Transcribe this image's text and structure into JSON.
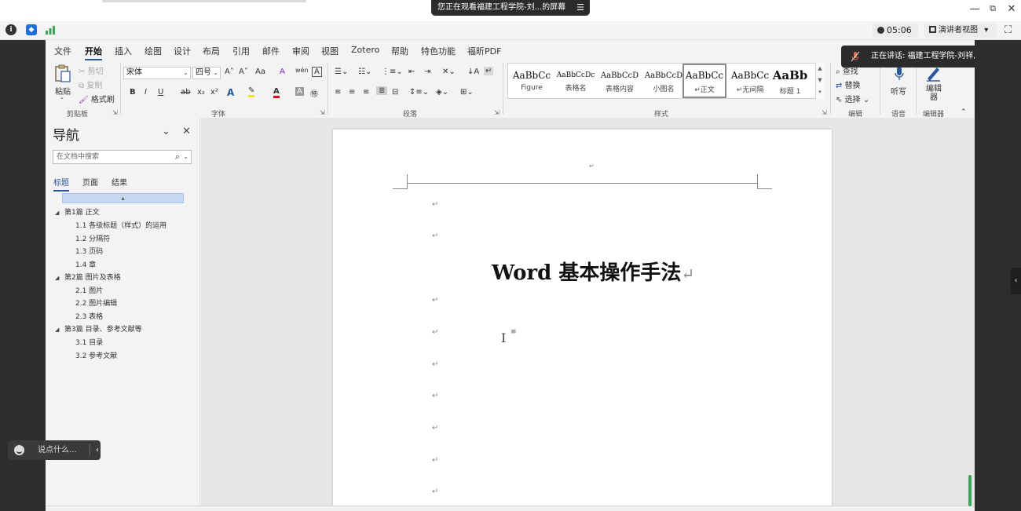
{
  "meeting": {
    "banner_text": "您正在观看福建工程学院-刘...的屏幕",
    "banner_collapse_icon": "☰",
    "minimize_icon": "—",
    "restore_icon": "⧉",
    "close_icon": "✕",
    "timer": "05:06",
    "presenter_view": "演讲者视图",
    "presenter_dropdown": "▾",
    "fullscreen_icon": "⛶",
    "speaking": "正在讲话: 福建工程学院-刘祥,",
    "chat_placeholder": "说点什么...",
    "chat_collapse": "‹",
    "side_tab_icon": "‹",
    "colors": {
      "dark": "#2d2d2d",
      "accent_green": "#3aa555",
      "info_blue": "#1e6fd9"
    }
  },
  "word": {
    "menu": [
      "文件",
      "开始",
      "插入",
      "绘图",
      "设计",
      "布局",
      "引用",
      "邮件",
      "审阅",
      "视图",
      "Zotero",
      "帮助",
      "特色功能",
      "福昕PDF"
    ],
    "active_menu": "开始",
    "ribbon": {
      "clipboard": {
        "paste": "粘贴",
        "cut": "剪切",
        "copy": "复制",
        "format_painter": "格式刷",
        "label": "剪贴板"
      },
      "font": {
        "name": "宋体",
        "size": "四号",
        "grow": "A˄",
        "shrink": "A˅",
        "case": "Aa",
        "clear": "A̶",
        "phonetic": "wén",
        "border": "A",
        "bold": "B",
        "italic": "I",
        "underline": "U",
        "strike": "ab",
        "subscript": "x₂",
        "superscript": "x²",
        "label": "字体"
      },
      "paragraph": {
        "label": "段落"
      },
      "styles": {
        "items": [
          {
            "sample": "AaBbCc",
            "name": "Figure"
          },
          {
            "sample": "AaBbCcDc",
            "name": "表格名"
          },
          {
            "sample": "AaBbCcD",
            "name": "表格内容"
          },
          {
            "sample": "AaBbCcD",
            "name": "小图名"
          },
          {
            "sample": "AaBbCc",
            "name": "↵正文"
          },
          {
            "sample": "AaBbCc",
            "name": "↵无间隔"
          },
          {
            "sample": "AaBb",
            "name": "标题 1"
          }
        ],
        "selected": "↵正文",
        "label": "样式"
      },
      "editing": {
        "find": "查找",
        "replace": "替换",
        "select": "选择",
        "label": "编辑"
      },
      "voice": {
        "dictate": "听写",
        "label": "语音"
      },
      "editor": {
        "name": "编辑器",
        "label": "编辑器"
      }
    },
    "nav": {
      "title": "导航",
      "search_placeholder": "在文档中搜索",
      "tabs": [
        "标题",
        "页面",
        "结果"
      ],
      "active_tab": "标题",
      "highlight_marker": "▴",
      "tree": [
        {
          "label": "第1篇 正文",
          "level": 1,
          "collapsed": false
        },
        {
          "label": "1.1 各级标题（样式）的运用",
          "level": 2
        },
        {
          "label": "1.2 分隔符",
          "level": 2
        },
        {
          "label": "1.3 页码",
          "level": 2
        },
        {
          "label": "1.4 章",
          "level": 2
        },
        {
          "label": "第2篇 图片及表格",
          "level": 1,
          "collapsed": false
        },
        {
          "label": "2.1 图片",
          "level": 2
        },
        {
          "label": "2.2 图片编辑",
          "level": 2
        },
        {
          "label": "2.3 表格",
          "level": 2
        },
        {
          "label": "第3篇 目录、参考文献等",
          "level": 1,
          "collapsed": false
        },
        {
          "label": "3.1 目录",
          "level": 2
        },
        {
          "label": "3.2 参考文献",
          "level": 2
        }
      ]
    },
    "document": {
      "title": "Word 基本操作手法",
      "paragraph_mark": "↵"
    }
  }
}
